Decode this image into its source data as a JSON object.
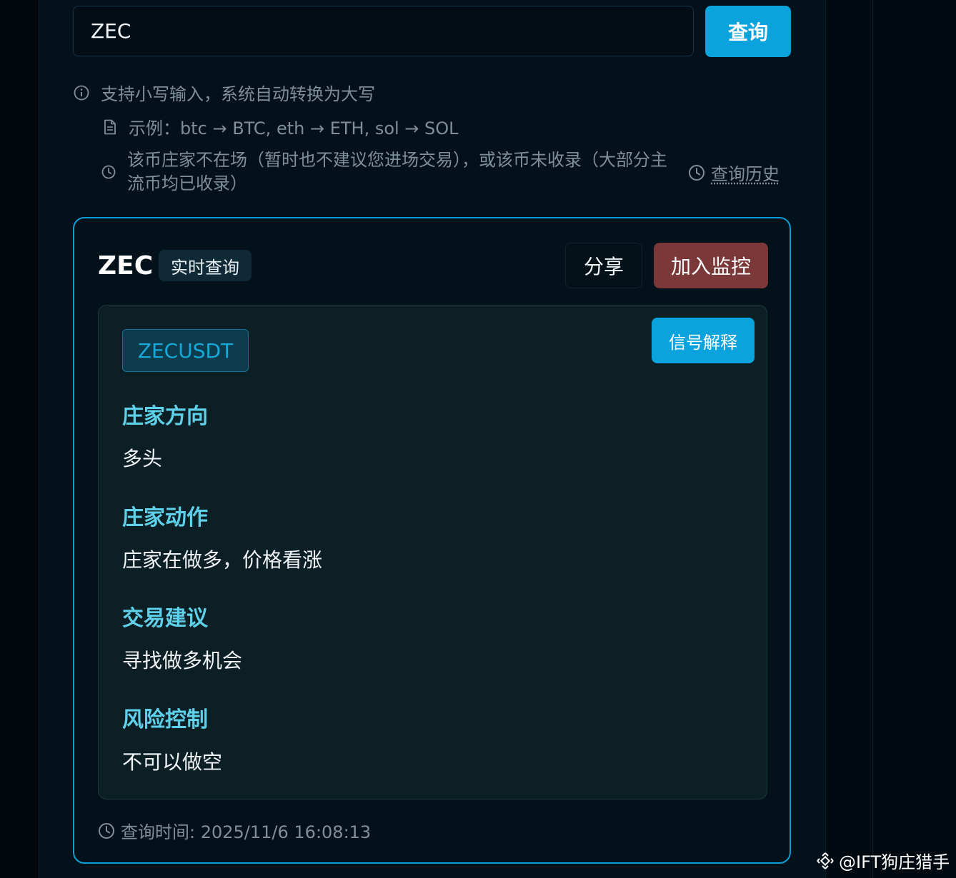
{
  "search": {
    "value": "ZEC",
    "button_label": "查询"
  },
  "hints": {
    "lowercase": "支持小写输入，系统自动转换为大写",
    "example": "示例：btc → BTC, eth → ETH, sol → SOL",
    "not_found": "该币庄家不在场（暂时也不建议您进场交易），或该币未收录（大部分主流币均已收录）",
    "history_link": "查询历史"
  },
  "result": {
    "coin": "ZEC",
    "badge": "实时查询",
    "share_label": "分享",
    "monitor_label": "加入监控",
    "monitor_color": "#7a3838",
    "accent_color": "#0aa3de",
    "pair": "ZECUSDT",
    "explain_label": "信号解释",
    "sections": [
      {
        "label": "庄家方向",
        "value": "多头"
      },
      {
        "label": "庄家动作",
        "value": "庄家在做多，价格看涨"
      },
      {
        "label": "交易建议",
        "value": "寻找做多机会"
      },
      {
        "label": "风险控制",
        "value": "不可以做空"
      }
    ],
    "query_time": "查询时间: 2025/11/6 16:08:13"
  },
  "watermark": "@IFT狗庄猎手",
  "icons": {
    "info": "info-icon",
    "document": "document-icon",
    "clock": "clock-icon",
    "logo": "binance-logo-icon"
  }
}
